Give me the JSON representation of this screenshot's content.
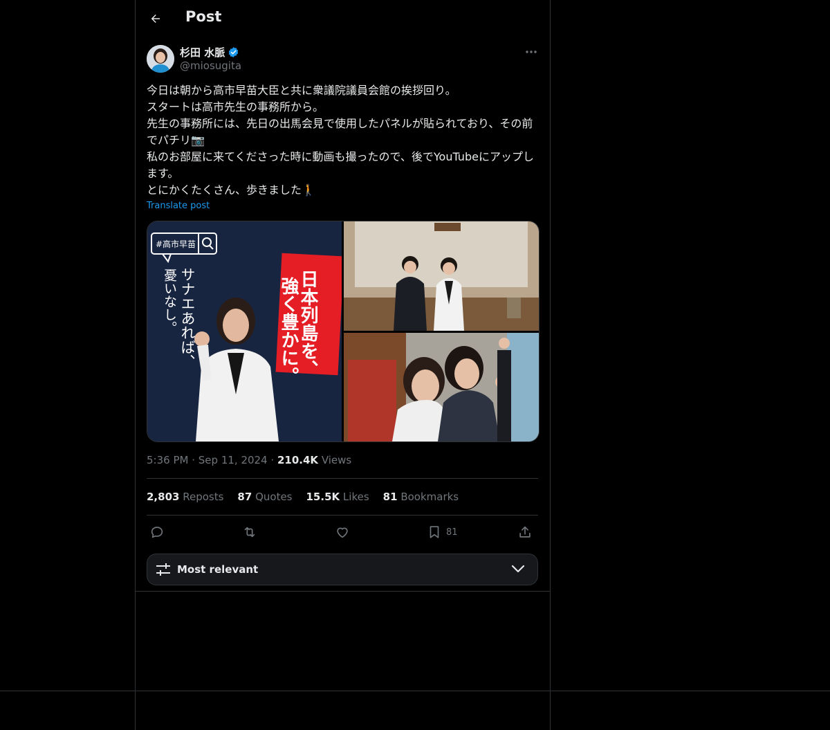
{
  "header": {
    "title": "Post"
  },
  "author": {
    "name": "杉田 水脈",
    "handle": "@miosugita"
  },
  "tweet": {
    "lines": [
      "今日は朝から高市早苗大臣と共に衆議院議員会館の挨拶回り。",
      "スタートは高市先生の事務所から。",
      "先生の事務所には、先日の出馬会見で使用したパネルが貼られており、その前でパチリ📷",
      "私のお部屋に来てくださった時に動画も撮ったので、後でYouTubeにアップします。",
      "とにかくたくさん、歩きました🚶"
    ],
    "translate_label": "Translate post"
  },
  "media": {
    "panel_tag": "#高市早苗",
    "panel_slogan_1": "サナエあれば、",
    "panel_slogan_2": "憂いなし。",
    "banner_line_1": "日本列島を、",
    "banner_line_2": "強く豊かに。"
  },
  "meta": {
    "time": "5:36 PM",
    "date": "Sep 11, 2024",
    "views_count": "210.4K",
    "views_label": "Views"
  },
  "stats": [
    {
      "count": "2,803",
      "label": "Reposts"
    },
    {
      "count": "87",
      "label": "Quotes"
    },
    {
      "count": "15.5K",
      "label": "Likes"
    },
    {
      "count": "81",
      "label": "Bookmarks"
    }
  ],
  "actions": {
    "bookmark_count": "81"
  },
  "sort": {
    "label": "Most relevant"
  },
  "colors": {
    "accent": "#1d9bf0",
    "text": "#e7e9ea",
    "muted": "#71767b",
    "border": "#2f3336",
    "background": "#000000"
  }
}
